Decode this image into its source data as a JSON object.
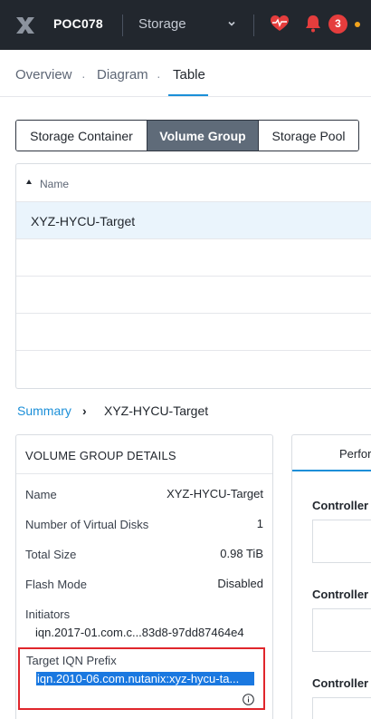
{
  "topbar": {
    "cluster": "POC078",
    "section": "Storage",
    "notifications": "3",
    "colors": {
      "bg": "#22272e",
      "alert": "#e53d3d",
      "warn": "#f2a41c"
    }
  },
  "subnav": {
    "items": [
      "Overview",
      "Diagram",
      "Table"
    ],
    "active": "Table"
  },
  "segmented": {
    "options": [
      "Storage Container",
      "Volume Group",
      "Storage Pool"
    ],
    "selected": "Volume Group"
  },
  "table": {
    "column": "Name",
    "rows": [
      "XYZ-HYCU-Target"
    ]
  },
  "breadcrumb": {
    "link": "Summary",
    "separator": "›",
    "current": "XYZ-HYCU-Target"
  },
  "details": {
    "title": "VOLUME GROUP DETAILS",
    "fields": [
      {
        "key": "Name",
        "value": "XYZ-HYCU-Target"
      },
      {
        "key": "Number of Virtual Disks",
        "value": "1"
      },
      {
        "key": "Total Size",
        "value": "0.98 TiB"
      },
      {
        "key": "Flash Mode",
        "value": "Disabled"
      }
    ],
    "initiators_label": "Initiators",
    "initiators_value": "iqn.2017-01.com.c...83d8-97dd87464e4",
    "target_label": "Target IQN Prefix",
    "target_value": "iqn.2010-06.com.nutanix:xyz-hycu-ta..."
  },
  "right_panel": {
    "tab": "Perfor",
    "controllers": [
      "Controller",
      "Controller",
      "Controller"
    ]
  }
}
